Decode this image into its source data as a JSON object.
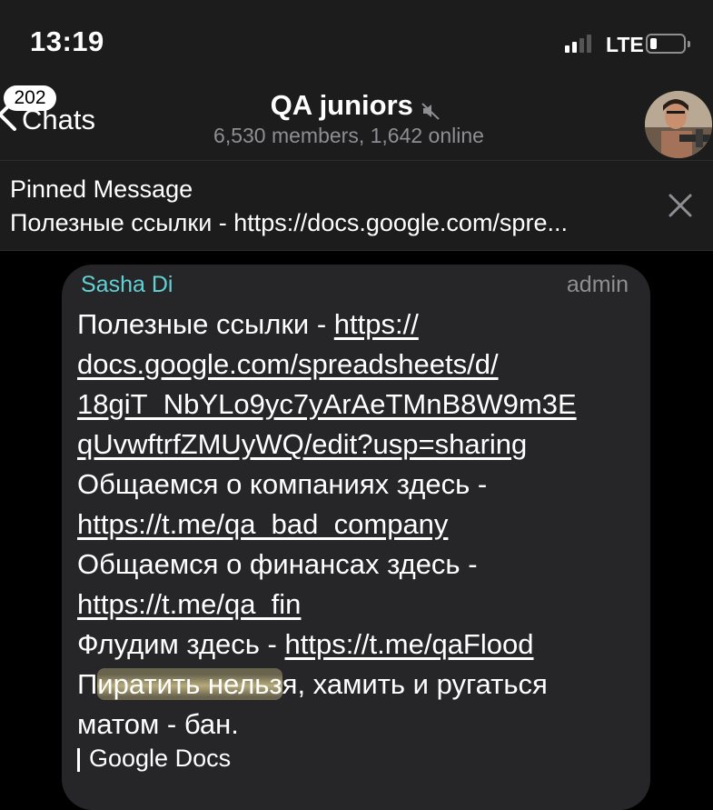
{
  "status_bar": {
    "time": "13:19",
    "network": "LTE",
    "battery_icon": "battery-low-icon"
  },
  "nav": {
    "badge_count": "202",
    "back_label": "Chats",
    "title": "QA juniors",
    "subtitle": "6,530 members, 1,642 online",
    "mute_icon": "muted-speaker-icon"
  },
  "pinned": {
    "title": "Pinned Message",
    "text": "Полезные ссылки - https://docs.google.com/spre...",
    "close_icon": "close-icon"
  },
  "message": {
    "sender": "Sasha Di",
    "role": "admin",
    "line1_text": "Полезные ссылки - ",
    "line1_link": "https://",
    "line2_link": "docs.google.com/spreadsheets/d/",
    "line3_link": "18giT_NbYLo9yc7yArAeTMnB8W9m3E",
    "line4_link": "qUvwftrfZMUyWQ/edit?usp=sharing",
    "line5_text": "Общаемся о компаниях здесь -",
    "line6_link": "https://t.me/qa_bad_company",
    "line7_text": "Общаемся о финансах здесь -",
    "line8_link": "https://t.me/qa_fin",
    "line9_text": "Флудим здесь - ",
    "line9_link": "https://t.me/qaFlood",
    "line10_first": "П",
    "line10_highlight": "иратить нельз",
    "line10_rest": "я, хамить и ругаться",
    "line11_text": "матом - бан.",
    "preview_title": "Google Docs"
  },
  "colors": {
    "sender": "#61d1d4",
    "bubble": "#262628",
    "bar": "#1c1c1d",
    "secondary": "#8e8e93"
  }
}
